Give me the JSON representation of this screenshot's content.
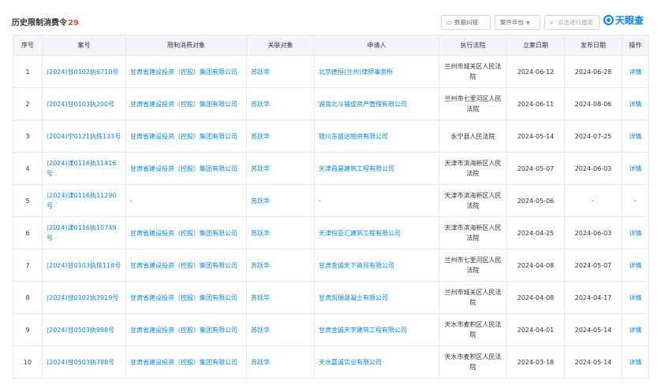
{
  "header": {
    "title": "历史限制消费令",
    "count": "29",
    "report_button": "数据纠错",
    "year_filter": "案件年份",
    "search_placeholder": "点击进行搜索",
    "logo_text": "天眼查"
  },
  "columns": [
    "序号",
    "案号",
    "限制消费对象",
    "关联对象",
    "申请人",
    "执行法院",
    "立案日期",
    "发布日期",
    "操作"
  ],
  "rows": [
    {
      "no": "1",
      "case": "(2024)甘0102执6710号",
      "target": "甘肃省建设投资（控股）集团有限公司",
      "related": "苏跃华",
      "applicant": "北京德恒(兰州)律师事务所",
      "court": "兰州市城关区人民法院",
      "filed": "2024-06-12",
      "published": "2024-06-28",
      "action": "详情"
    },
    {
      "no": "2",
      "case": "(2024)甘0103执200号",
      "target": "甘肃省建设投资（控股）集团有限公司",
      "related": "苏跃华",
      "applicant": "湖南北斗辅成资产管理有限公司",
      "court": "兰州市七里河区人民法院",
      "filed": "2024-06-11",
      "published": "2024-08-06",
      "action": "详情"
    },
    {
      "no": "3",
      "case": "(2024)宁0121执恢133号",
      "target": "甘肃省建设投资（控股）集团有限公司",
      "related": "苏跃华",
      "applicant": "银川东盛达物资有限公司",
      "court": "永宁县人民法院",
      "filed": "2024-05-14",
      "published": "2024-07-25",
      "action": "详情"
    },
    {
      "no": "4",
      "case": "(2024)津0116执11416号",
      "target": "甘肃省建设投资（控股）集团有限公司",
      "related": "苏跃华",
      "applicant": "天津昌昊建筑工程有限公司",
      "court": "天津市滨海新区人民法院",
      "filed": "2024-05-07",
      "published": "2024-06-03",
      "action": "详情"
    },
    {
      "no": "5",
      "case": "(2024)津0116执11290号",
      "target": "-",
      "related": "苏跃华",
      "applicant": "-",
      "court": "天津市滨海新区人民法院",
      "filed": "2024-05-06",
      "published": "-",
      "action": "-"
    },
    {
      "no": "6",
      "case": "(2024)津0116执10749号",
      "target": "甘肃省建设投资（控股）集团有限公司",
      "related": "苏跃华",
      "applicant": "天津恒亚汇建筑工程有限公司",
      "court": "天津市滨海新区人民法院",
      "filed": "2024-04-25",
      "published": "2024-06-03",
      "action": "详情"
    },
    {
      "no": "7",
      "case": "(2024)甘0103执恢118号",
      "target": "甘肃省建设投资（控股）集团有限公司",
      "related": "苏跃华",
      "applicant": "甘肃金诚天下商贸有限公司",
      "court": "兰州市七里河区人民法院",
      "filed": "2024-04-08",
      "published": "2024-05-07",
      "action": "详情"
    },
    {
      "no": "8",
      "case": "(2024)甘0102执3919号",
      "target": "甘肃省建设投资（控股）集团有限公司",
      "related": "苏跃华",
      "applicant": "甘肃凯瑞混凝土有限公司",
      "court": "兰州市城关区人民法院",
      "filed": "2024-04-08",
      "published": "2024-04-17",
      "action": "详情"
    },
    {
      "no": "9",
      "case": "(2024)甘0503执988号",
      "target": "甘肃省建设投资（控股）集团有限公司",
      "related": "苏跃华",
      "applicant": "甘肃金诚天宇建筑工程有限公司",
      "court": "天水市麦积区人民法院",
      "filed": "2024-04-01",
      "published": "2024-05-14",
      "action": "详情"
    },
    {
      "no": "10",
      "case": "(2024)甘0503执788号",
      "target": "甘肃省建设投资（控股）集团有限公司",
      "related": "苏跃华",
      "applicant": "天水嘉诚实业有限公司",
      "court": "天水市麦积区人民法院",
      "filed": "2024-03-18",
      "published": "2024-05-14",
      "action": "详情"
    }
  ]
}
